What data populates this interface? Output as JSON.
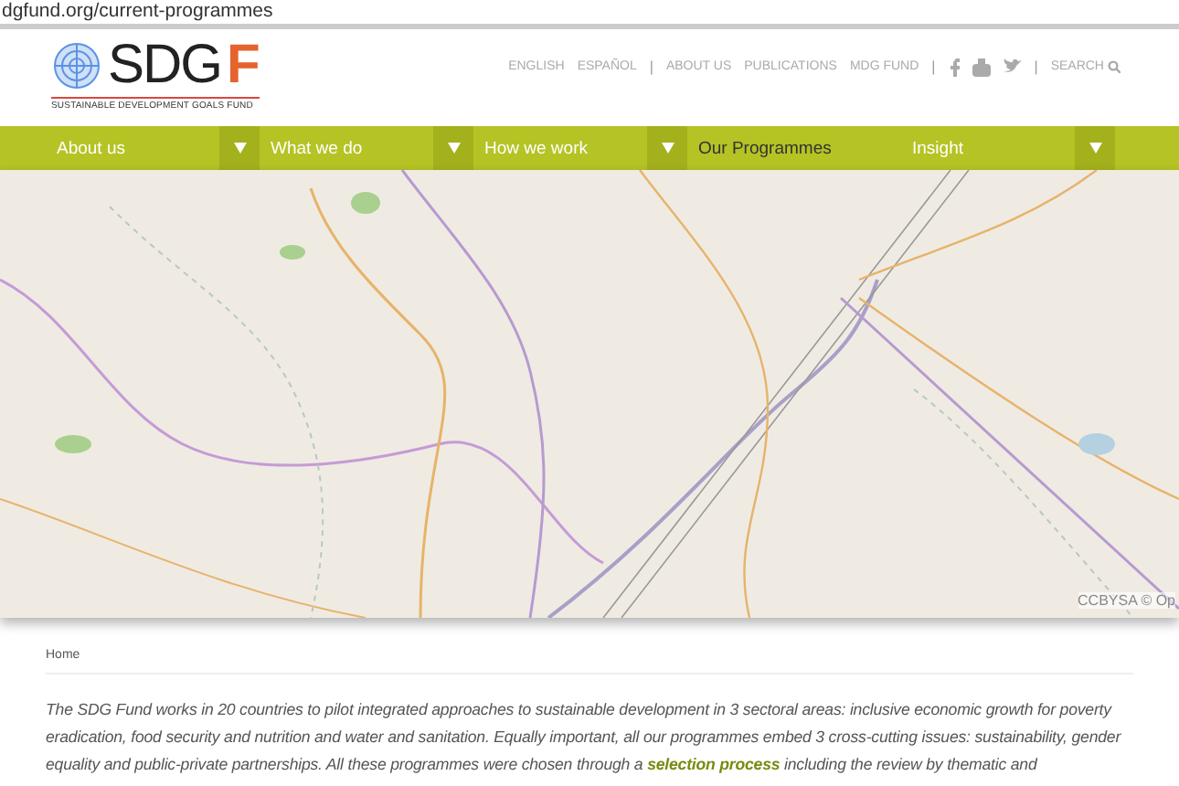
{
  "address_bar": {
    "url": "dgfund.org/current-programmes"
  },
  "header": {
    "logo": {
      "wordmark": "SDG",
      "mark": "F",
      "tagline": "SUSTAINABLE DEVELOPMENT GOALS FUND"
    },
    "top_links": [
      {
        "kind": "link",
        "label": "ENGLISH"
      },
      {
        "kind": "link",
        "label": "ESPAÑOL"
      },
      {
        "kind": "separator",
        "label": "|"
      },
      {
        "kind": "link",
        "label": "ABOUT US"
      },
      {
        "kind": "link",
        "label": "PUBLICATIONS"
      },
      {
        "kind": "link",
        "label": "MDG FUND"
      },
      {
        "kind": "separator",
        "label": "|"
      },
      {
        "kind": "social"
      },
      {
        "kind": "separator",
        "label": "|"
      },
      {
        "kind": "search",
        "label": "SEARCH"
      }
    ]
  },
  "nav": [
    {
      "label": "About us",
      "selected": false,
      "dropdown": true
    },
    {
      "label": "What we do",
      "selected": false,
      "dropdown": true
    },
    {
      "label": "How we work",
      "selected": false,
      "dropdown": true
    },
    {
      "label": "Our Programmes",
      "selected": true,
      "dropdown": false
    },
    {
      "label": "Insight",
      "selected": false,
      "dropdown": true
    }
  ],
  "map": {
    "attribution": "CCBYSA © Op"
  },
  "breadcrumb": "Home",
  "intro": {
    "text_before": "The SDG Fund works in 20 countries to pilot integrated approaches to sustainable development in 3 sectoral areas: inclusive economic growth for poverty eradication, food security and nutrition and water and sanitation. Equally important, all our programmes embed 3 cross-cutting issues: sustainability, gender equality and public-private partnerships. All these programmes were chosen through a ",
    "link": "selection process",
    "text_after": " including the review by thematic and"
  }
}
